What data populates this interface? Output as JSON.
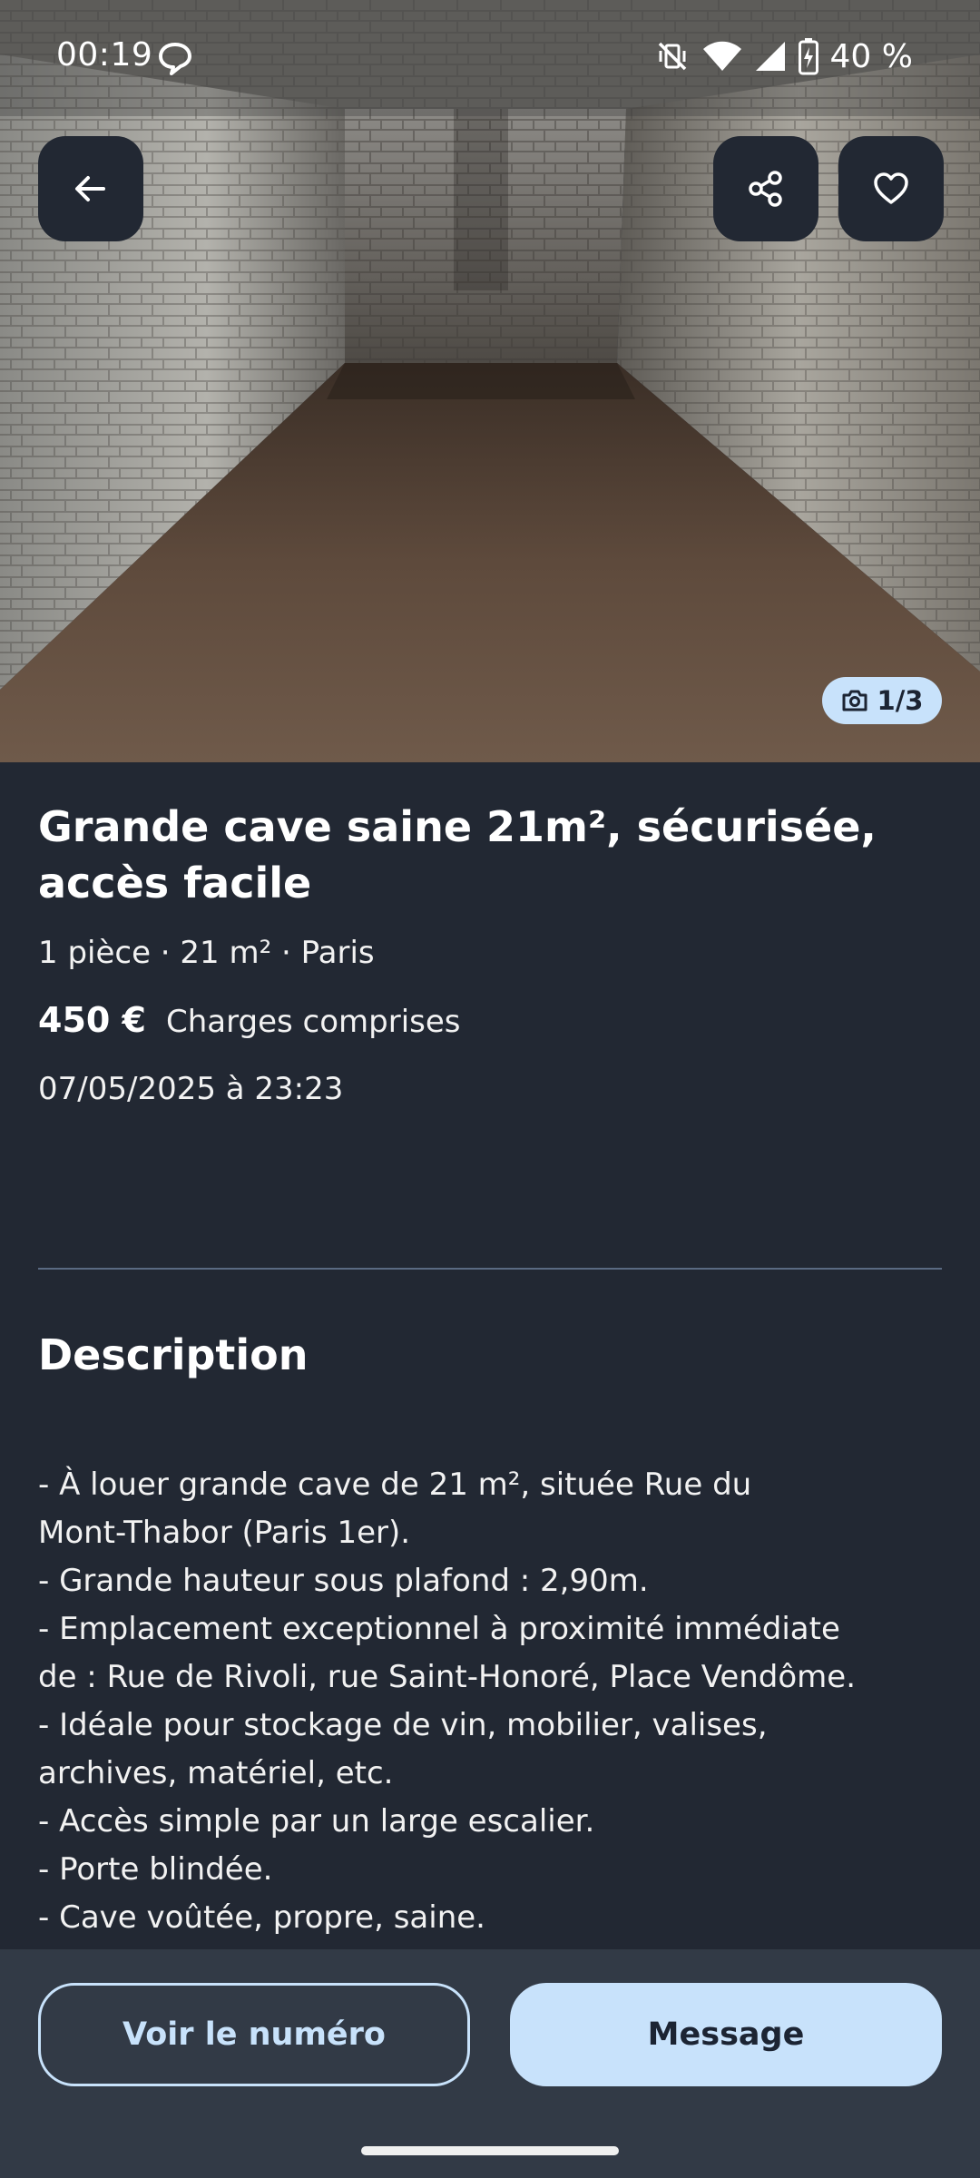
{
  "status_bar": {
    "time": "00:19",
    "battery": "40 %",
    "icons": [
      "chat-bubble-icon",
      "mute-vibrate-icon",
      "wifi-icon",
      "signal-icon",
      "battery-charging-icon"
    ]
  },
  "photo": {
    "counter": "1/3",
    "counter_icon": "camera-icon",
    "buttons": {
      "back_icon": "arrow-left-icon",
      "share_icon": "share-icon",
      "favorite_icon": "heart-icon"
    }
  },
  "listing": {
    "title": "Grande cave saine 21m², sécurisée, accès facile",
    "meta": "1 pièce · 21 m² · Paris",
    "price": "450 €",
    "charges": "Charges comprises",
    "date": "07/05/2025 à 23:23"
  },
  "description": {
    "heading": "Description",
    "lines": [
      "- À louer grande cave de 21 m², située Rue du",
      "Mont-Thabor (Paris 1er).",
      "- Grande hauteur sous plafond : 2,90m.",
      "- Emplacement exceptionnel à proximité immédiate",
      "de : Rue de Rivoli, rue Saint-Honoré, Place Vendôme.",
      "- Idéale pour stockage de vin, mobilier, valises,",
      "archives, matériel, etc.",
      "- Accès simple par un large escalier.",
      "- Porte blindée.",
      "- Cave voûtée, propre, saine."
    ]
  },
  "actions": {
    "show_number": "Voir le numéro",
    "message": "Message"
  },
  "colors": {
    "background": "#222833",
    "accent": "#c8e2fb",
    "bottom_bar": "#323a46",
    "divider": "#5a6a82"
  }
}
